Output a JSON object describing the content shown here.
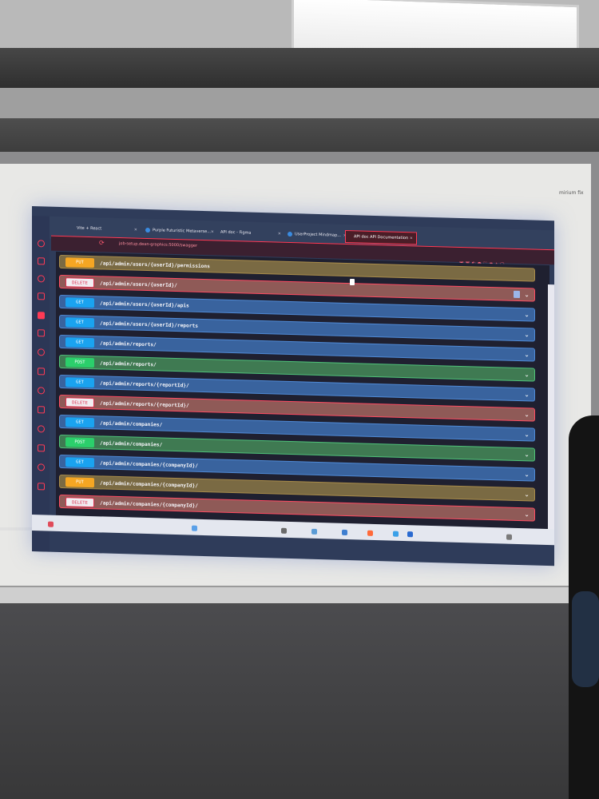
{
  "browser": {
    "tabs": [
      {
        "label": "Vite + React"
      },
      {
        "label": "Purple Futuristic Metaverse..."
      },
      {
        "label": "API doc - Figma"
      },
      {
        "label": "UserProject Mindmap..."
      },
      {
        "label": "API doc API Documentation",
        "active": true
      }
    ],
    "url": "job-setup.dean-graphics:5000/swagger"
  },
  "endpoints": [
    {
      "method": "PUT",
      "path": "/api/admin/users/{userId}/permissions",
      "color": "#f5a623"
    },
    {
      "method": "DELETE",
      "path": "/api/admin/users/{userId}/",
      "color": "#e03050"
    },
    {
      "method": "GET",
      "path": "/api/admin/users/{userId}/apis",
      "color": "#1aa3f0"
    },
    {
      "method": "GET",
      "path": "/api/admin/users/{userId}/reports",
      "color": "#1aa3f0"
    },
    {
      "method": "GET",
      "path": "/api/admin/reports/",
      "color": "#1aa3f0"
    },
    {
      "method": "POST",
      "path": "/api/admin/reports/",
      "color": "#2bcf6b"
    },
    {
      "method": "GET",
      "path": "/api/admin/reports/{reportId}/",
      "color": "#1aa3f0"
    },
    {
      "method": "DELETE",
      "path": "/api/admin/reports/{reportId}/",
      "color": "#e03050"
    },
    {
      "method": "GET",
      "path": "/api/admin/companies/",
      "color": "#1aa3f0"
    },
    {
      "method": "POST",
      "path": "/api/admin/companies/",
      "color": "#2bcf6b"
    },
    {
      "method": "GET",
      "path": "/api/admin/companies/{companyId}/",
      "color": "#1aa3f0"
    },
    {
      "method": "PUT",
      "path": "/api/admin/companies/{companyId}/",
      "color": "#f5a623"
    },
    {
      "method": "DELETE",
      "path": "/api/admin/companies/{companyId}/",
      "color": "#e03050"
    }
  ],
  "icons": {
    "expand": "chevron-down-icon",
    "sidebar": [
      "home-icon",
      "bag-icon",
      "circle-icon",
      "grid-icon",
      "active-square-icon",
      "gamepad-icon",
      "arrow-icon",
      "wifi-icon",
      "settings-icon",
      "box-icon",
      "heart-icon",
      "list-icon",
      "clock-icon",
      "camera-icon"
    ]
  },
  "screen_label": "mirium fix"
}
